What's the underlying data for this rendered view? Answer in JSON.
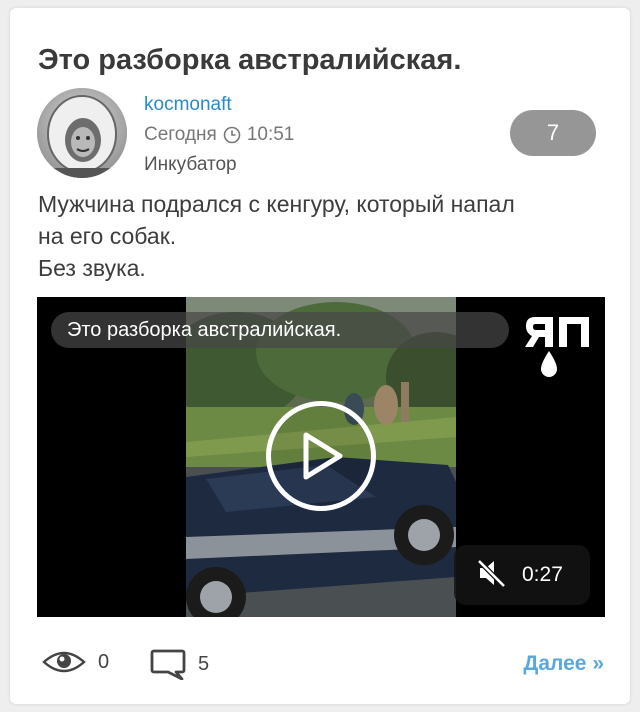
{
  "post": {
    "title": "Это разборка австралийская.",
    "author": "kocmonaft",
    "date": "Сегодня",
    "time": "10:51",
    "category": "Инкубатор",
    "rating": "7",
    "description_lines": [
      "Мужчина подрался с кенгуру, который напал",
      "на его собак.",
      "Без звука."
    ]
  },
  "video": {
    "title": "Это разборка австралийская.",
    "duration": "0:27",
    "logo_icon": "yap-logo-icon",
    "play_icon": "play-icon",
    "mute_icon": "muted-speaker-icon"
  },
  "footer": {
    "views": "0",
    "comments": "5",
    "more_label": "Далее »"
  },
  "colors": {
    "author_link": "#2a8ac8",
    "more_link": "#5aa7dd",
    "badge_bg": "#969696"
  }
}
